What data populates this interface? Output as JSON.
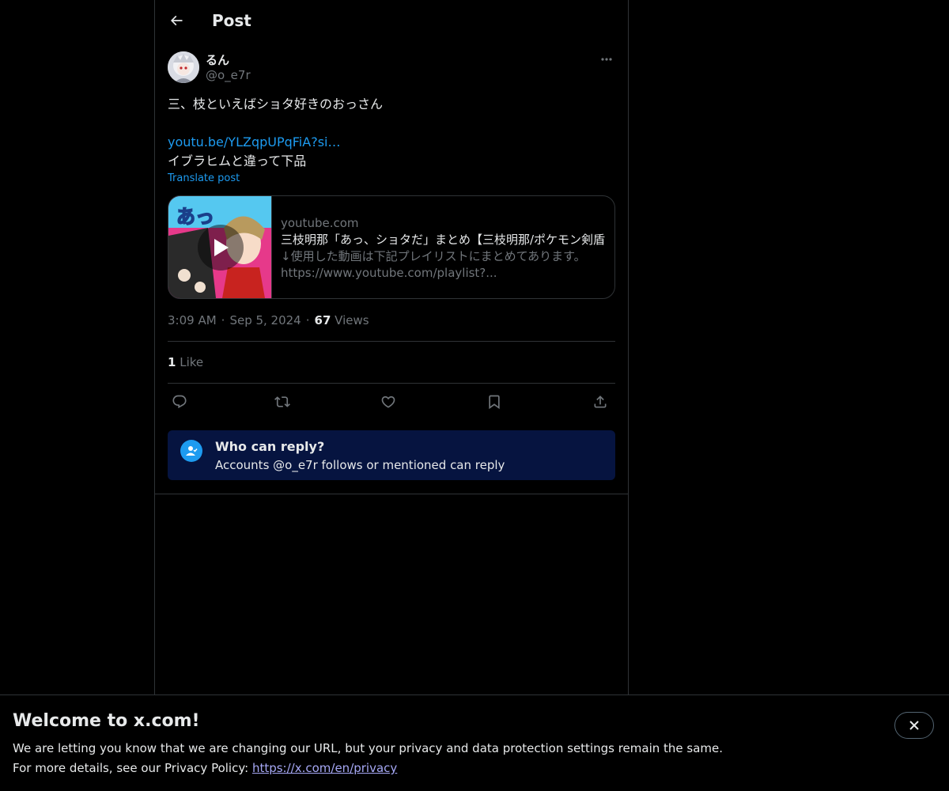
{
  "header": {
    "title": "Post",
    "back_icon": "arrow-left-icon"
  },
  "post": {
    "author_name": "るん",
    "author_handle": "@o_e7r",
    "lines": [
      "三、枝といえばショタ好きのおっさん",
      "",
      "youtu.be/YLZqpUPqFiA?si…",
      "イブラヒムと違って下品"
    ],
    "translate_label": "Translate post",
    "card": {
      "domain": "youtube.com",
      "title": "三枝明那「あっ、ショタだ」まとめ【三枝明那/ポケモン剣盾",
      "desc_line1": "↓使用した動画は下記プレイリストにまとめてあります。",
      "desc_line2": "https://www.youtube.com/playlist?..."
    },
    "time": "3:09 AM",
    "date": "Sep 5, 2024",
    "views_count": "67",
    "views_label": "Views",
    "like_count": "1",
    "like_label": "Like"
  },
  "reply_restriction": {
    "title": "Who can reply?",
    "subtitle": "Accounts @o_e7r follows or mentioned can reply"
  },
  "banner": {
    "title": "Welcome to x.com!",
    "line1": "We are letting you know that we are changing our URL, but your privacy and data protection settings remain the same.",
    "line2_prefix": "For more details, see our Privacy Policy: ",
    "link": "https://x.com/en/privacy"
  },
  "colors": {
    "accent": "#1d9bf0",
    "muted": "#71767b",
    "border": "#2f3336",
    "reply_bg": "#061440"
  }
}
